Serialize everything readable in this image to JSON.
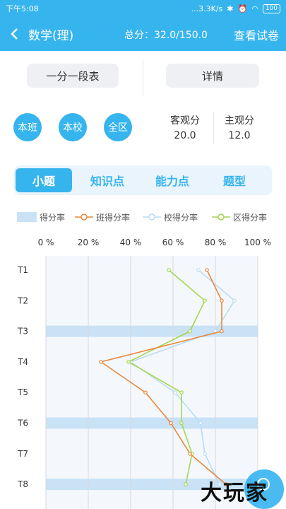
{
  "status_bar": {
    "time": "下午5:08",
    "speed": "...3.3K/s",
    "battery": "100"
  },
  "header": {
    "title": "数学(理)",
    "score": "总分：32.0/150.0",
    "view_paper": "查看试卷"
  },
  "buttons": {
    "one_point_table": "一分一段表",
    "details": "详情"
  },
  "scopes": [
    "本班",
    "本校",
    "全区"
  ],
  "scores": {
    "objective_label": "客观分",
    "objective_value": "20.0",
    "subjective_label": "主观分",
    "subjective_value": "12.0"
  },
  "tabs": [
    {
      "label": "小题",
      "active": true
    },
    {
      "label": "知识点",
      "active": false
    },
    {
      "label": "能力点",
      "active": false
    },
    {
      "label": "题型",
      "active": false
    }
  ],
  "legend": {
    "score_rate": "得分率",
    "class_rate": "班得分率",
    "school_rate": "校得分率",
    "district_rate": "区得分率"
  },
  "watermark": "大玩家",
  "colors": {
    "accent": "#36b4ee",
    "class": "#e8883a",
    "school": "#b9dcf2",
    "district": "#a6d64e",
    "bar": "#c9e2f6"
  },
  "chart_data": {
    "type": "line",
    "orientation": "horizontal",
    "xlim": [
      0,
      100
    ],
    "x_ticks": [
      "0 %",
      "20 %",
      "40 %",
      "60 %",
      "80 %",
      "100 %"
    ],
    "categories": [
      "T1",
      "T2",
      "T3",
      "T4",
      "T5",
      "T6",
      "T7",
      "T8"
    ],
    "bars": [
      0,
      0,
      100,
      0,
      0,
      100,
      0,
      100
    ],
    "series": [
      {
        "name": "班得分率",
        "values": [
          76,
          83,
          83,
          26,
          47,
          59,
          68,
          85
        ]
      },
      {
        "name": "校得分率",
        "values": [
          72,
          89,
          80,
          40,
          61,
          73,
          75,
          82
        ]
      },
      {
        "name": "区得分率",
        "values": [
          58,
          75,
          68,
          39,
          64,
          64,
          69,
          66
        ]
      }
    ]
  }
}
